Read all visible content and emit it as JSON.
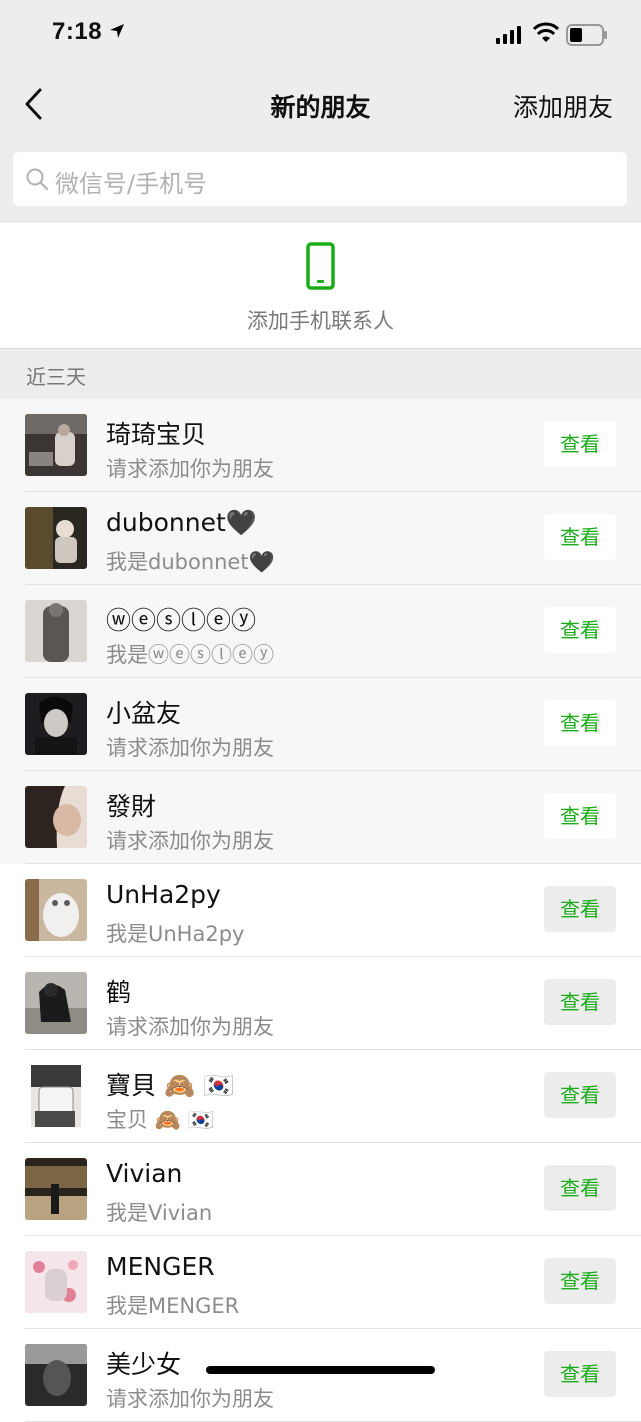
{
  "status": {
    "time": "7:18"
  },
  "nav": {
    "title": "新的朋友",
    "add_label": "添加朋友"
  },
  "search": {
    "placeholder": "微信号/手机号"
  },
  "phone_contacts": {
    "label": "添加手机联系人"
  },
  "section": {
    "label": "近三天"
  },
  "button_label": "查看",
  "colors": {
    "accent": "#1aad19",
    "nav_bg": "#ededed"
  },
  "friends": [
    {
      "name": "琦琦宝贝",
      "msg": "请求添加你为朋友",
      "unread": true
    },
    {
      "name": "dubonnet🖤",
      "msg": "我是dubonnet🖤",
      "unread": true
    },
    {
      "name": "ⓦⓔⓢⓛⓔⓨ",
      "msg": "我是ⓦⓔⓢⓛⓔⓨ",
      "unread": true
    },
    {
      "name": "小盆友",
      "msg": "请求添加你为朋友",
      "unread": true
    },
    {
      "name": "發財",
      "msg": "请求添加你为朋友",
      "unread": true
    },
    {
      "name": "UnHa2py",
      "msg": "我是UnHa2py",
      "unread": false
    },
    {
      "name": "鹤",
      "msg": "请求添加你为朋友",
      "unread": false
    },
    {
      "name": "寶貝 🙈 🇰🇷",
      "msg": "宝贝 🙈 🇰🇷",
      "unread": false
    },
    {
      "name": "Vivian",
      "msg": "我是Vivian",
      "unread": false
    },
    {
      "name": "MENGER",
      "msg": "我是MENGER",
      "unread": false
    },
    {
      "name": "美少女",
      "msg": "请求添加你为朋友",
      "unread": false
    }
  ]
}
